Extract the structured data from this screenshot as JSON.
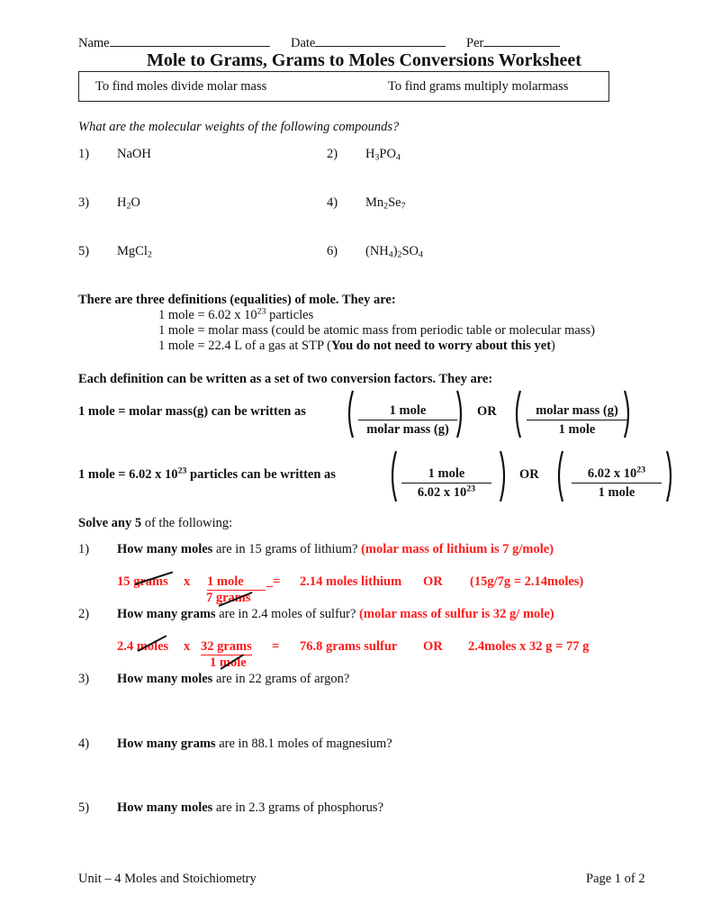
{
  "header": {
    "name_label": "Name",
    "date_label": "Date",
    "per_label": "Per",
    "title": "Mole to Grams, Grams to Moles Conversions Worksheet",
    "tip_left": "To find moles divide molar mass",
    "tip_right": "To find grams multiply molarmass"
  },
  "part1": {
    "prompt": "What are the molecular weights of the following compounds?",
    "items": [
      {
        "num": "1)",
        "formula": [
          {
            "t": "NaOH"
          }
        ]
      },
      {
        "num": "2)",
        "formula": [
          {
            "t": "H"
          },
          {
            "sub": "3"
          },
          {
            "t": "PO"
          },
          {
            "sub": "4"
          }
        ]
      },
      {
        "num": "3)",
        "formula": [
          {
            "t": "H"
          },
          {
            "sub": "2"
          },
          {
            "t": "O"
          }
        ]
      },
      {
        "num": "4)",
        "formula": [
          {
            "t": "Mn"
          },
          {
            "sub": "2"
          },
          {
            "t": "Se"
          },
          {
            "sub": "7"
          }
        ]
      },
      {
        "num": "5)",
        "formula": [
          {
            "t": "MgCl"
          },
          {
            "sub": "2"
          }
        ]
      },
      {
        "num": "6)",
        "formula": [
          {
            "t": "(NH"
          },
          {
            "sub": "4"
          },
          {
            "t": ")"
          },
          {
            "sub": "2"
          },
          {
            "t": "SO"
          },
          {
            "sub": "4"
          }
        ]
      }
    ]
  },
  "definitions": {
    "heading": "There are three definitions (equalities) of mole. They are:",
    "line1_pre": "1 mole = 6.02 x 10",
    "line1_exp": "23",
    "line1_post": " particles",
    "line2": "1 mole = molar mass (could be atomic mass from periodic table or molecular mass)",
    "line3_pre": "1 mole = 22.4 L of a gas at STP (",
    "line3_bold": "You do not need to worry about this yet",
    "line3_post": ")"
  },
  "conversion": {
    "heading": "Each definition can be written as a set of two conversion factors. They are:",
    "row1_label": "1 mole = molar mass(g) can be written as",
    "row1_f1_num": "1 mole",
    "row1_f1_den": "molar mass (g)",
    "row1_or": "OR",
    "row1_f2_num": "molar mass (g)",
    "row1_f2_den": "1 mole",
    "row2_label_pre": "1 mole = 6.02 x 10",
    "row2_label_exp": "23",
    "row2_label_post": " particles can be written as",
    "row2_f1_num": "1 mole",
    "row2_f1_den_pre": "6.02 x 10",
    "row2_f1_den_exp": "23",
    "row2_or": "OR",
    "row2_f2_num_pre": "6.02 x 10",
    "row2_f2_num_exp": "23",
    "row2_f2_den": "1 mole"
  },
  "problems": {
    "intro_bold": "Solve any 5",
    "intro_rest": " of the following:",
    "items": [
      {
        "num": "1)",
        "bold": "How many moles",
        "rest": " are in 15 grams of lithium? ",
        "hint": "(molar mass of lithium is 7 g/mole)"
      },
      {
        "num": "2)",
        "bold": "How many grams",
        "rest": " are in 2.4 moles of sulfur? ",
        "hint": "(molar mass of sulfur is 32 g/ mole)"
      },
      {
        "num": "3)",
        "bold": "How many moles",
        "rest": " are in 22 grams of argon?"
      },
      {
        "num": "4)",
        "bold": "How many grams",
        "rest": " are in 88.1 moles of magnesium?"
      },
      {
        "num": "5)",
        "bold": "How many moles",
        "rest": " are in 2.3 grams of phosphorus?"
      }
    ],
    "answer1": {
      "given": "15 grams",
      "times": "x",
      "num": "1 mole",
      "den": "7 grams",
      "equals": "_=",
      "result": "2.14 moles lithium",
      "or": "OR",
      "alt": "(15g/7g  =  2.14moles)"
    },
    "answer2": {
      "given": "2.4 moles",
      "times": "x",
      "num": "32 grams",
      "den": "1 mole",
      "equals": "=",
      "result": "76.8 grams sulfur",
      "or": "OR",
      "alt": "2.4moles x 32 g = 77 g"
    }
  },
  "footer": {
    "left": "Unit – 4 Moles and Stoichiometry",
    "right": "Page 1 of 2"
  },
  "colors": {
    "answer_red": "#ff1a1a",
    "text": "#111111"
  }
}
